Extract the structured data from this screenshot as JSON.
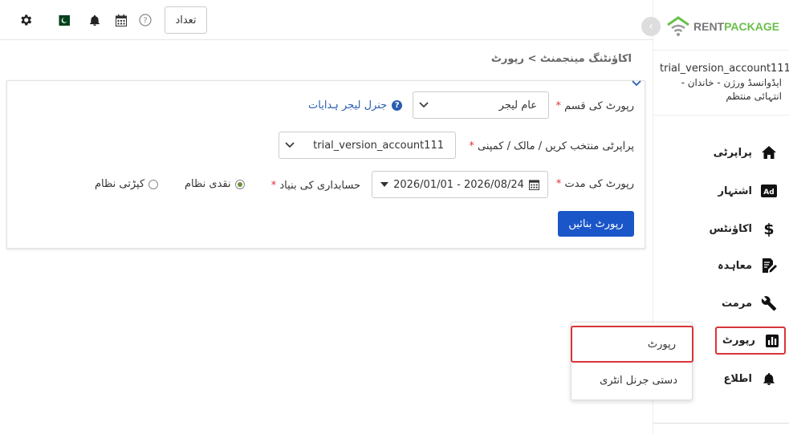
{
  "topbar": {
    "count_button": "تعداد",
    "icons": [
      "gear-icon",
      "pakistan-flag-icon",
      "bell-icon",
      "calendar-icon",
      "help-icon"
    ]
  },
  "logo": {
    "part1": "RENT",
    "part2": "PACKAGE"
  },
  "account": {
    "name": "trial_version_account111",
    "plan_line1": "ایڈوانسڈ ورژن - خاندان -",
    "plan_line2": "انتہائی منتظم"
  },
  "nav": {
    "items": [
      {
        "label": "پراپرٹی",
        "icon": "home-icon"
      },
      {
        "label": "اشتہار",
        "icon": "ad-icon"
      },
      {
        "label": "اکاؤنٹس",
        "icon": "dollar-icon"
      },
      {
        "label": "معاہدہ",
        "icon": "contract-icon"
      },
      {
        "label": "مرمت",
        "icon": "wrench-icon"
      },
      {
        "label": "رپورٹ",
        "icon": "bar-chart-icon"
      },
      {
        "label": "اطلاع",
        "icon": "bell-icon"
      }
    ]
  },
  "popup": {
    "items": [
      "رپورٹ",
      "دستی جرنل انٹری"
    ]
  },
  "breadcrumb": "اکاؤنٹنگ مینجمنٹ > رپورٹ",
  "form": {
    "report_type_label": "رپورٹ کی قسم",
    "report_type_value": "عام لیجر",
    "help_link": "جنرل لیجر ہدایات",
    "property_label": "پراپرٹی منتخب کریں / مالک / کمپنی",
    "property_value": "trial_version_account111",
    "period_label": "رپورٹ کی مدت",
    "period_value": "2026/01/01 - 2026/08/24",
    "basis_label": "حسابداری کی بنیاد",
    "basis_cash": "نقدی نظام",
    "basis_accrual": "کپڑتی نظام",
    "basis_selected": "cash",
    "required_marker": "*",
    "generate_button": "رپورٹ بنائیں"
  },
  "colors": {
    "primary": "#1a56c8",
    "active_border": "#d9343a",
    "logo_green": "#6abf4b"
  }
}
